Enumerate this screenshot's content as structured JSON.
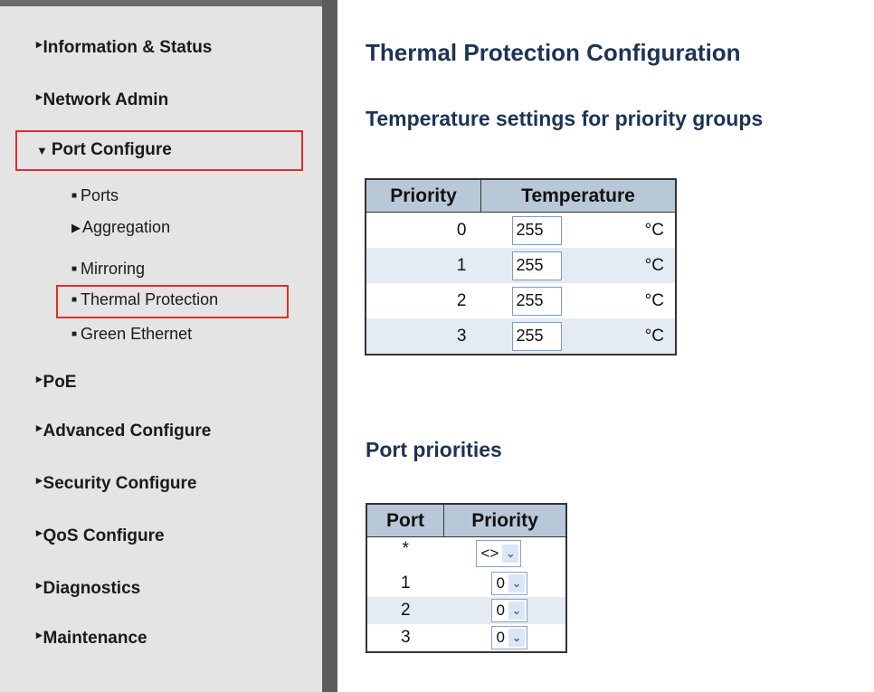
{
  "sidebar": {
    "items": [
      {
        "label": "Information & Status",
        "expanded": false
      },
      {
        "label": "Network Admin",
        "expanded": false
      },
      {
        "label": "Port Configure",
        "expanded": true,
        "children": [
          {
            "label": "Ports",
            "kind": "bullet"
          },
          {
            "label": "Aggregation",
            "kind": "arrow"
          },
          {
            "label": "Mirroring",
            "kind": "bullet"
          },
          {
            "label": "Thermal Protection",
            "kind": "bullet",
            "selected": true
          },
          {
            "label": "Green Ethernet",
            "kind": "bullet"
          }
        ]
      },
      {
        "label": "PoE",
        "expanded": false
      },
      {
        "label": "Advanced Configure",
        "expanded": false
      },
      {
        "label": "Security Configure",
        "expanded": false
      },
      {
        "label": "QoS Configure",
        "expanded": false
      },
      {
        "label": "Diagnostics",
        "expanded": false
      },
      {
        "label": "Maintenance",
        "expanded": false
      }
    ],
    "icons": {
      "collapsed": "right-triangle-icon",
      "expanded": "down-triangle-icon",
      "bullet": "square-bullet-icon"
    }
  },
  "main": {
    "title": "Thermal Protection Configuration",
    "temp_section": {
      "heading": "Temperature settings for priority groups",
      "headers": [
        "Priority",
        "Temperature"
      ],
      "unit": "°C",
      "rows": [
        {
          "priority": "0",
          "temperature": "255"
        },
        {
          "priority": "1",
          "temperature": "255"
        },
        {
          "priority": "2",
          "temperature": "255"
        },
        {
          "priority": "3",
          "temperature": "255"
        }
      ]
    },
    "port_section": {
      "heading": "Port priorities",
      "headers": [
        "Port",
        "Priority"
      ],
      "rows": [
        {
          "port": "*",
          "priority": "<>"
        },
        {
          "port": "1",
          "priority": "0"
        },
        {
          "port": "2",
          "priority": "0"
        },
        {
          "port": "3",
          "priority": "0"
        }
      ]
    }
  },
  "colors": {
    "sidebar_bg": "#e4e4e4",
    "highlight": "#e52b2b",
    "heading": "#1d3354",
    "table_header": "#b8c8d8",
    "row_alt": "#e4ebf2"
  }
}
